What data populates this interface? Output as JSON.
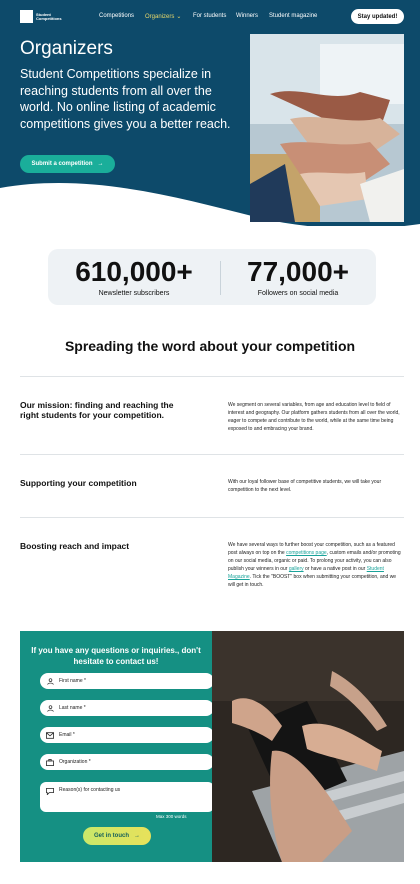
{
  "nav": {
    "logo_text": "Student Competitions",
    "links": [
      "Competitions",
      "Organizers",
      "For students",
      "Winners",
      "Student magazine"
    ],
    "stay_updated": "Stay updated!"
  },
  "hero": {
    "title": "Organizers",
    "subtitle": "Student Competitions specialize in reaching students from all over the world. No online listing of academic competitions gives you a better reach.",
    "cta_label": "Submit a competition",
    "cta_arrow": "→"
  },
  "stats": [
    {
      "value": "610,000+",
      "label": "Newsletter subscribers"
    },
    {
      "value": "77,000+",
      "label": "Followers on social media"
    }
  ],
  "section_title": "Spreading the word about your competition",
  "rows": [
    {
      "heading": "Our mission: finding and reaching the right students for your competition.",
      "text": "We segment on several variables, from age and education level to field of interest and geography. Our platform gathers students from all over the world, eager to compete and contribute to the world, while at the same time being exposed to and embracing your brand."
    },
    {
      "heading": "Supporting your competition",
      "text": "With our loyal follower base of competitive students, we will take your competition to the next level."
    },
    {
      "heading": "Boosting reach and impact",
      "text_parts": {
        "p1": "We have several ways to further boost your competition, such as a featured post always on top on the ",
        "link1": "competitions page",
        "p2": ", custom emails and/or promoting on our social media, organic or paid. To prolong your activity, you can also publish your winners in our ",
        "link2": "gallery",
        "p3": " or have a native post in our ",
        "link3": "Student Magazine",
        "p4": ". Tick the \"BOOST\" box when submitting your competition, and we will get in touch."
      }
    }
  ],
  "contact": {
    "title": "If you have any questions or inquiries., don't hesitate to contact us!",
    "fields": [
      {
        "label": "First name *",
        "icon": "person-icon"
      },
      {
        "label": "Last name *",
        "icon": "person-icon"
      },
      {
        "label": "Email *",
        "icon": "mail-icon"
      },
      {
        "label": "Organization *",
        "icon": "briefcase-icon"
      }
    ],
    "reason_label": "Reason(s) for contacting us",
    "max_words": "Max 300 words",
    "submit_label": "Get in touch",
    "submit_arrow": "→"
  },
  "colors": {
    "hero_bg": "#0d4a6a",
    "accent_teal": "#1aae9a",
    "contact_bg": "#159083",
    "nav_active": "#e8d86a"
  }
}
